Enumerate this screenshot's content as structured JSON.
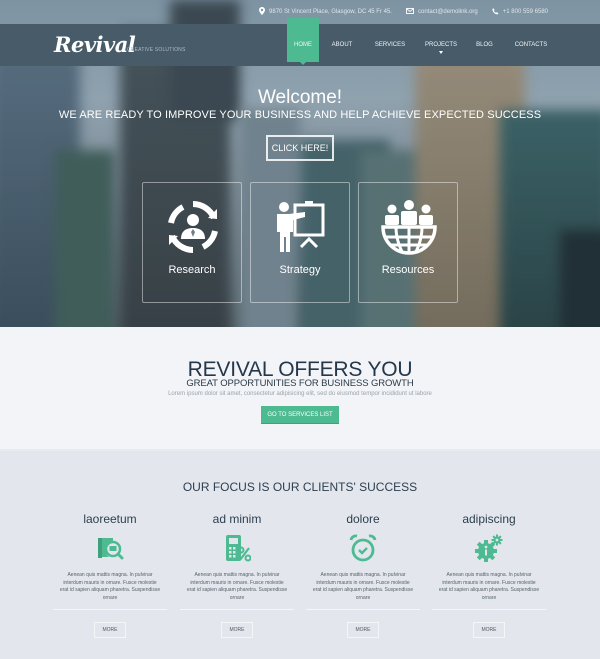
{
  "topbar": {
    "address": "9870 St Vincent Place, Glasgow, DC 45 Fr 45.",
    "email": "contact@demolink.org",
    "phone": "+1 800 559 6580"
  },
  "brand": {
    "logo": "Revival",
    "tagline": "CREATIVE SOLUTIONS"
  },
  "nav": {
    "items": [
      {
        "label": "HOME",
        "active": true
      },
      {
        "label": "ABOUT"
      },
      {
        "label": "SERVICES"
      },
      {
        "label": "PROJECTS",
        "dropdown": true
      },
      {
        "label": "BLOG"
      },
      {
        "label": "CONTACTS"
      }
    ]
  },
  "hero": {
    "title": "Welcome!",
    "subtitle": "WE ARE READY TO IMPROVE YOUR BUSINESS AND HELP ACHIEVE EXPECTED SUCCESS",
    "cta_label": "CLICK HERE!",
    "features": [
      {
        "label": "Research",
        "icon": "research-cycle-icon"
      },
      {
        "label": "Strategy",
        "icon": "presentation-icon"
      },
      {
        "label": "Resources",
        "icon": "global-team-icon"
      }
    ]
  },
  "offers": {
    "title": "REVIVAL OFFERS YOU",
    "subtitle": "GREAT OPPORTUNITIES FOR BUSINESS GROWTH",
    "text": "Lorem ipsum dolor sit amet, consectetur adipisicing elit, sed do eiusmod tempor incididunt ut labore",
    "button_label": "GO TO SERVICES LIST"
  },
  "focus": {
    "title": "OUR FOCUS IS OUR CLIENTS' SUCCESS",
    "columns": [
      {
        "title": "laoreetum",
        "icon": "search-document-icon",
        "text": "Aenean quis mattis magna. In pulvinar interdum mauris in ornare. Fusce molestie erat id sapien aliquam pharetra. Suspendisse ornare",
        "more_label": "MORE"
      },
      {
        "title": "ad minim",
        "icon": "calculator-percent-icon",
        "text": "Aenean quis mattis magna. In pulvinar interdum mauris in ornare. Fusce molestie erat id sapien aliquam pharetra. Suspendisse ornare",
        "more_label": "MORE"
      },
      {
        "title": "dolore",
        "icon": "alarm-clock-icon",
        "text": "Aenean quis mattis magna. In pulvinar interdum mauris in ornare. Fusce molestie erat id sapien aliquam pharetra. Suspendisse ornare",
        "more_label": "MORE"
      },
      {
        "title": "adipiscing",
        "icon": "gears-info-icon",
        "text": "Aenean quis mattis magna. In pulvinar interdum mauris in ornare. Fusce molestie erat id sapien aliquam pharetra. Suspendisse ornare",
        "more_label": "MORE"
      }
    ]
  },
  "colors": {
    "accent": "#4dba92",
    "navbar": "#475b68",
    "heading": "#25374a",
    "offers_bg": "#f2f4f7",
    "focus_bg": "#e3e7ed"
  }
}
